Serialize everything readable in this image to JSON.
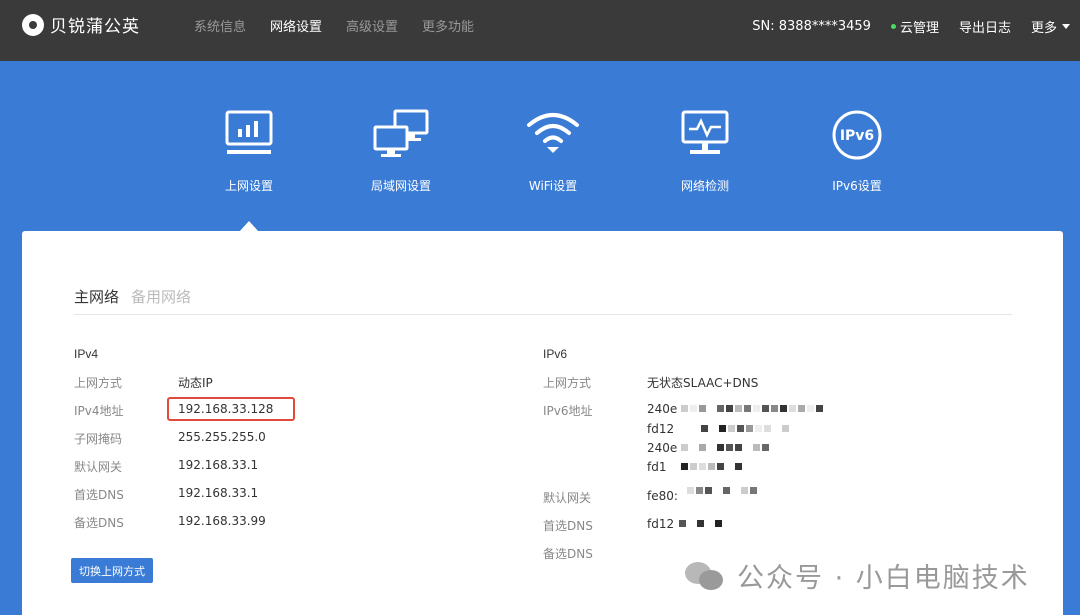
{
  "app": {
    "logo_text": "贝锐蒲公英"
  },
  "topnav": {
    "items": [
      {
        "label": "系统信息",
        "active": false
      },
      {
        "label": "网络设置",
        "active": true
      },
      {
        "label": "高级设置",
        "active": false
      },
      {
        "label": "更多功能",
        "active": false
      }
    ]
  },
  "topright": {
    "sn": "SN:  8388****3459",
    "cloud": "云管理",
    "export_log": "导出日志",
    "more": "更多"
  },
  "tabs": [
    {
      "label": "上网设置",
      "icon": "monitor-chart-icon"
    },
    {
      "label": "局域网设置",
      "icon": "lan-monitors-icon"
    },
    {
      "label": "WiFi设置",
      "icon": "wifi-icon"
    },
    {
      "label": "网络检测",
      "icon": "network-check-icon"
    },
    {
      "label": "IPv6设置",
      "icon": "ipv6-icon",
      "icon_text": "IPv6"
    }
  ],
  "subtabs": {
    "primary": "主网络",
    "backup": "备用网络"
  },
  "ipv4": {
    "title": "IPv4",
    "rows": [
      {
        "key": "上网方式",
        "value": "动态IP"
      },
      {
        "key": "IPv4地址",
        "value": "192.168.33.128"
      },
      {
        "key": "子网掩码",
        "value": "255.255.255.0"
      },
      {
        "key": "默认网关",
        "value": "192.168.33.1"
      },
      {
        "key": "首选DNS",
        "value": "192.168.33.1"
      },
      {
        "key": "备选DNS",
        "value": "192.168.33.99"
      }
    ],
    "switch_button": "切换上网方式"
  },
  "ipv6": {
    "title": "IPv6",
    "mode_key": "上网方式",
    "mode_value": "无状态SLAAC+DNS",
    "address_key": "IPv6地址",
    "address_values": [
      "240e",
      "fd12",
      "240e",
      "fd1"
    ],
    "gateway_key": "默认网关",
    "gateway_value": "fe80:",
    "dns1_key": "首选DNS",
    "dns1_value": "fd12",
    "dns2_key": "备选DNS"
  },
  "watermark": {
    "text": "公众号 · 小白电脑技术"
  },
  "colors": {
    "topbar": "#3a3a3a",
    "banner": "#3a7bd5",
    "highlight": "#e04a3a",
    "button": "#3a7bd5"
  }
}
